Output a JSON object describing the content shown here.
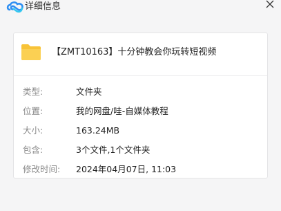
{
  "window": {
    "title": "详细信息",
    "logo_icon": "baidu-netdisk-logo",
    "close_icon": "close-icon"
  },
  "file": {
    "icon": "folder-icon",
    "name": "【ZMT10163】十分钟教会你玩转短视频"
  },
  "properties": [
    {
      "label": "类型:",
      "value": "文件夹"
    },
    {
      "label": "位置:",
      "value": "我的网盘/哇-自媒体教程"
    },
    {
      "label": "大小:",
      "value": "163.24MB"
    },
    {
      "label": "包含:",
      "value": "3个文件,1个文件夹"
    },
    {
      "label": "修改时间:",
      "value": "2024年04月07日, 11:03"
    }
  ],
  "colors": {
    "folder": "#f8c338",
    "label": "#8a8a8a",
    "logo_blue": "#2e8ef2",
    "logo_cyan": "#34c7f0"
  }
}
